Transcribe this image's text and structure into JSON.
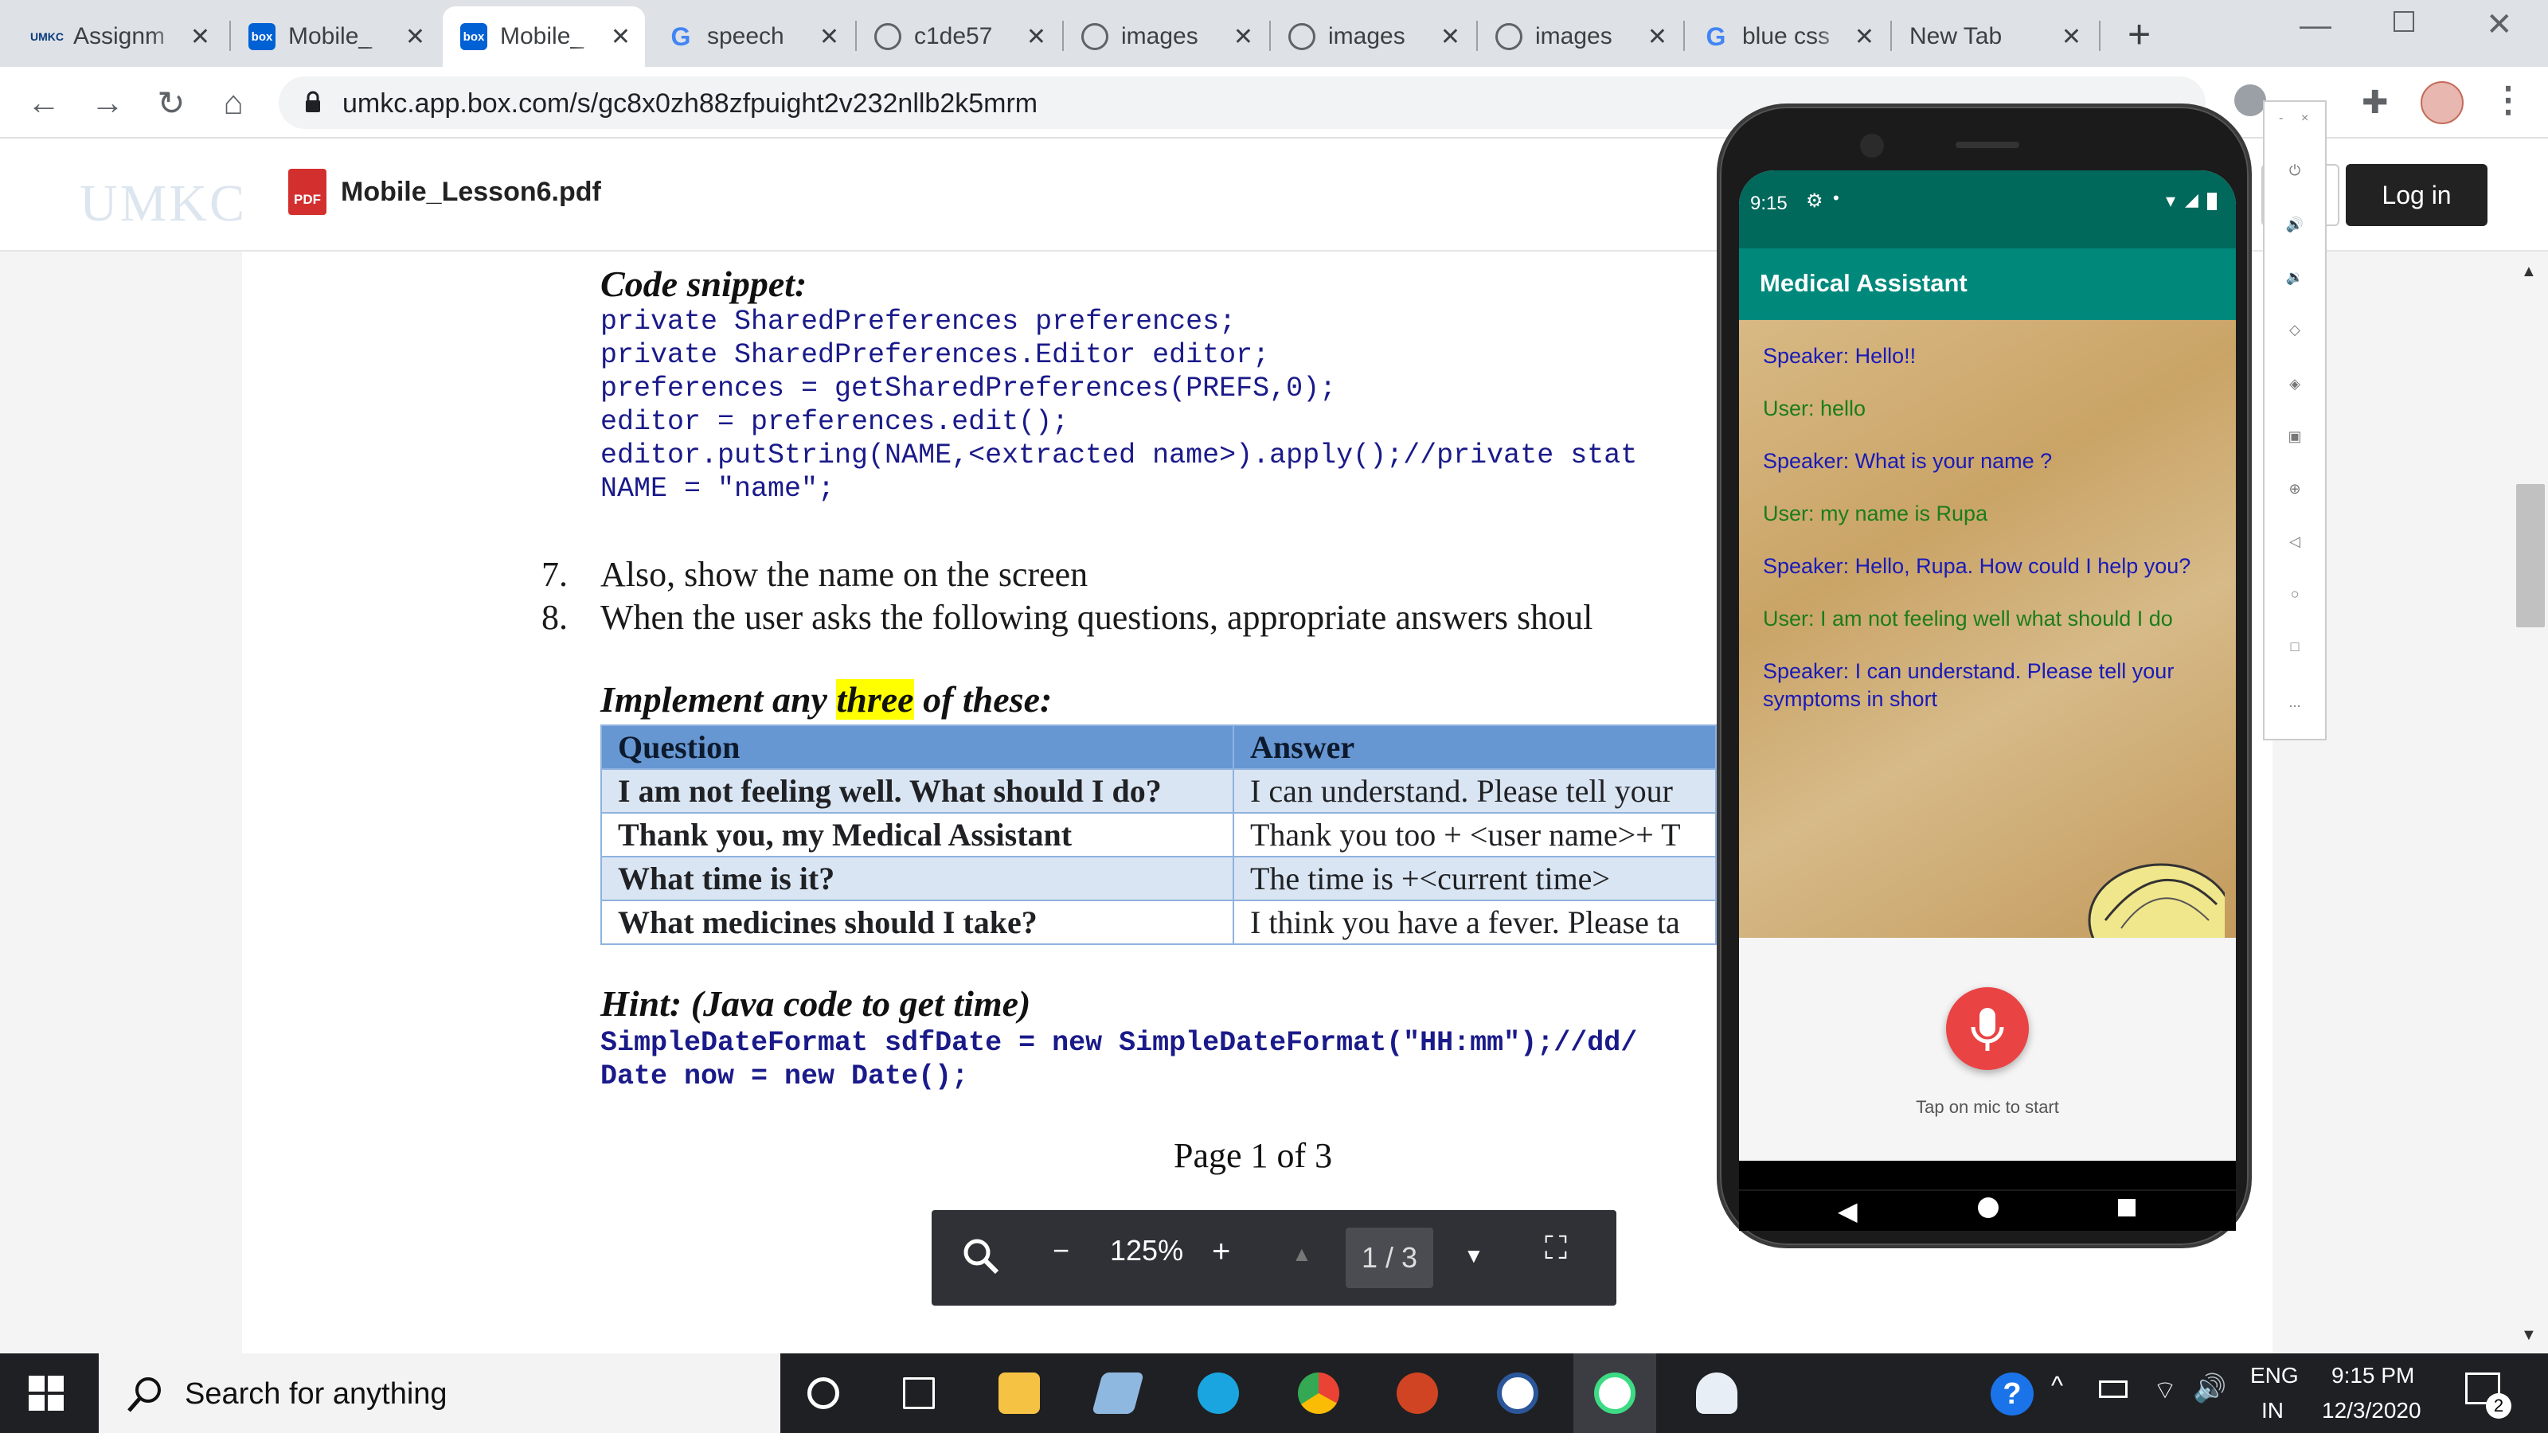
{
  "browser": {
    "tabs": [
      {
        "icon": "UMKC",
        "title": "Assignm"
      },
      {
        "icon": "box",
        "title": "Mobile_"
      },
      {
        "icon": "box",
        "title": "Mobile_",
        "active": true
      },
      {
        "icon": "G",
        "title": "speech"
      },
      {
        "icon": "globe",
        "title": "c1de57"
      },
      {
        "icon": "globe",
        "title": "images"
      },
      {
        "icon": "globe",
        "title": "images"
      },
      {
        "icon": "globe",
        "title": "images"
      },
      {
        "icon": "G",
        "title": "blue css"
      },
      {
        "icon": "",
        "title": "New Tab"
      }
    ],
    "new_tab": "+",
    "url": "umkc.app.box.com/s/gc8x0zh88zfpuight2v232nllb2k5mrm"
  },
  "box": {
    "logo_text": "UMKC",
    "pdf_badge": "PDF",
    "filename": "Mobile_Lesson6.pdf",
    "login_label": "Log in"
  },
  "doc": {
    "code_heading": "Code snippet:",
    "code_lines": [
      "private SharedPreferences preferences;",
      "private SharedPreferences.Editor editor;",
      "preferences = getSharedPreferences(PREFS,0);",
      "editor = preferences.edit();",
      "editor.putString(NAME,<extracted name>).apply();//private stat",
      "NAME = \"name\";"
    ],
    "items": [
      {
        "num": "7.",
        "text": "Also, show the name on the screen"
      },
      {
        "num": "8.",
        "text": "When the user asks the following questions, appropriate answers shoul"
      }
    ],
    "implement_prefix": "Implement any ",
    "implement_highlight": "three",
    "implement_suffix": " of these:",
    "table_headers": [
      "Question",
      "Answer"
    ],
    "table_rows": [
      [
        "I am not feeling well. What should I do?",
        "I can understand. Please tell your"
      ],
      [
        "Thank you, my Medical Assistant",
        "Thank you too + <user name>+ T"
      ],
      [
        "What time is it?",
        "The time is +<current time>"
      ],
      [
        "What medicines should I take?",
        "I think you have a fever. Please ta"
      ]
    ],
    "hint_heading": "Hint: (Java code to get time)",
    "hint_lines": [
      "SimpleDateFormat sdfDate = new SimpleDateFormat(\"HH:mm\");//dd/",
      "Date now = new Date();"
    ],
    "page_label": "Page 1 of 3"
  },
  "pdf_toolbar": {
    "zoom": "125%",
    "minus": "−",
    "plus": "+",
    "page": "1 / 3"
  },
  "phone": {
    "time": "9:15",
    "app_title": "Medical Assistant",
    "messages": [
      {
        "role": "speaker",
        "text": "Speaker: Hello!!"
      },
      {
        "role": "user",
        "text": "User: hello"
      },
      {
        "role": "speaker",
        "text": "Speaker: What is your name ?"
      },
      {
        "role": "user",
        "text": "User: my name is Rupa"
      },
      {
        "role": "speaker",
        "text": "Speaker: Hello, Rupa. How could I help you?"
      },
      {
        "role": "user",
        "text": "User: I am not feeling well what should I do"
      },
      {
        "role": "speaker",
        "text": "Speaker: I can understand. Please tell your symptoms in short"
      }
    ],
    "tap_hint": "Tap on mic to start",
    "colors": {
      "status_bar": "#00695c",
      "app_bar": "#00897b",
      "speaker": "#1a1ab8",
      "user": "#1b7c1b",
      "mic": "#ea4343"
    }
  },
  "emulator_sidebar": {
    "top_labels": [
      "-",
      "×"
    ],
    "more": "..."
  },
  "taskbar": {
    "search_placeholder": "Search for anything",
    "lang_top": "ENG",
    "lang_bottom": "IN",
    "time": "9:15 PM",
    "date": "12/3/2020",
    "notif_count": "2"
  }
}
